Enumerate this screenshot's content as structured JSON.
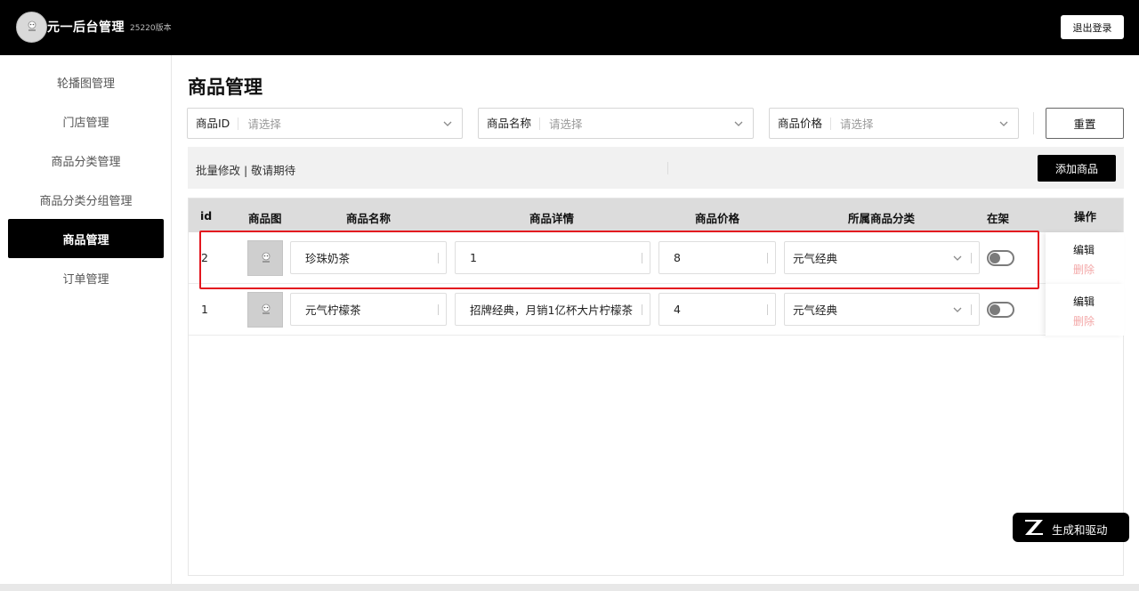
{
  "header": {
    "app_title": "元一后台管理",
    "version": "25220版本",
    "logout_label": "退出登录"
  },
  "sidebar": {
    "items": [
      {
        "label": "轮播图管理",
        "active": false
      },
      {
        "label": "门店管理",
        "active": false
      },
      {
        "label": "商品分类管理",
        "active": false
      },
      {
        "label": "商品分类分组管理",
        "active": false
      },
      {
        "label": "商品管理",
        "active": true
      },
      {
        "label": "订单管理",
        "active": false
      }
    ]
  },
  "main": {
    "title": "商品管理",
    "filters": [
      {
        "label": "商品ID",
        "placeholder": "请选择"
      },
      {
        "label": "商品名称",
        "placeholder": "请选择"
      },
      {
        "label": "商品价格",
        "placeholder": "请选择"
      }
    ],
    "reset_label": "重置",
    "batch_text": "批量修改 | 敬请期待",
    "add_label": "添加商品",
    "table": {
      "headers": [
        "id",
        "商品图",
        "商品名称",
        "商品详情",
        "商品价格",
        "所属商品分类",
        "在架",
        "操作"
      ],
      "rows": [
        {
          "id": "2",
          "name": "珍珠奶茶",
          "detail": "1",
          "price": "8",
          "category": "元气经典",
          "on_shelf": false,
          "edit": "编辑",
          "delete": "删除"
        },
        {
          "id": "1",
          "name": "元气柠檬茶",
          "detail": "招牌经典，月销1亿杯大片柠檬茶",
          "price": "4",
          "category": "元气经典",
          "on_shelf": false,
          "edit": "编辑",
          "delete": "删除"
        }
      ]
    }
  },
  "badge": {
    "label": "生成和驱动"
  },
  "colors": {
    "accent": "#000000",
    "highlight": "#e3161f",
    "delete": "#f3a7a7"
  }
}
